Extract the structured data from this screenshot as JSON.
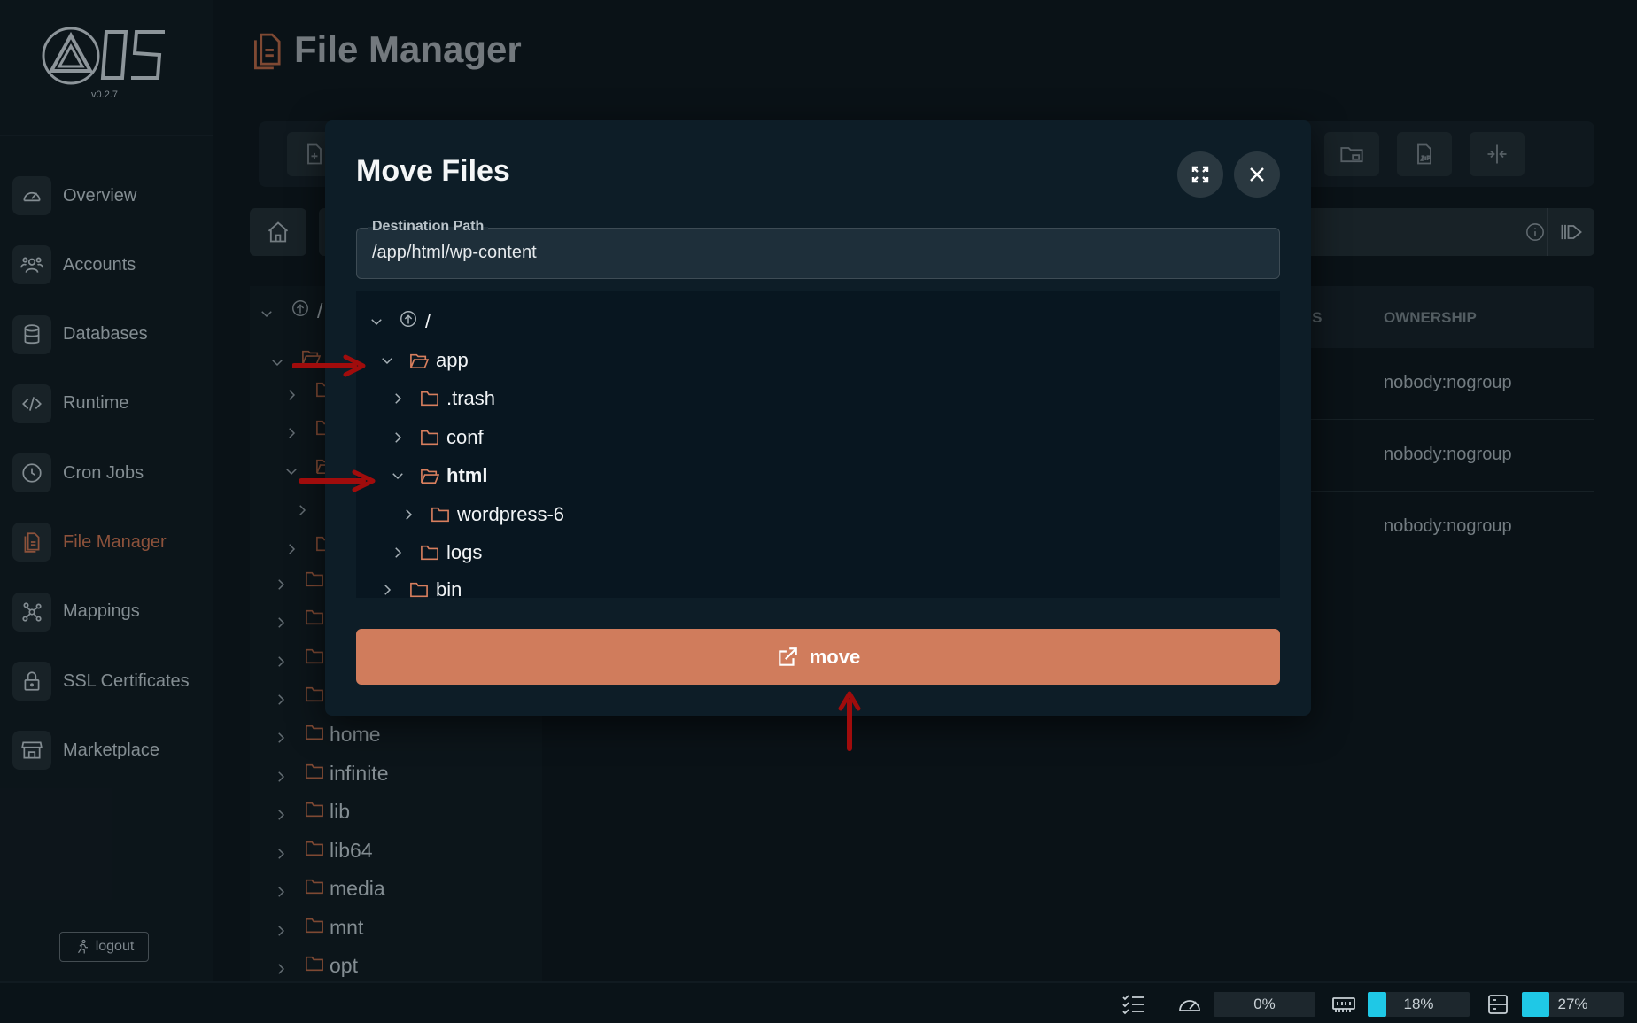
{
  "app": {
    "version": "v0.2.7"
  },
  "sidebar": {
    "items": [
      {
        "label": "Overview",
        "icon": "speedometer-icon"
      },
      {
        "label": "Accounts",
        "icon": "users-icon"
      },
      {
        "label": "Databases",
        "icon": "database-icon"
      },
      {
        "label": "Runtime",
        "icon": "code-icon"
      },
      {
        "label": "Cron Jobs",
        "icon": "clock-icon"
      },
      {
        "label": "File Manager",
        "icon": "file-manager-icon",
        "active": true
      },
      {
        "label": "Mappings",
        "icon": "mappings-icon"
      },
      {
        "label": "SSL Certificates",
        "icon": "lock-icon"
      },
      {
        "label": "Marketplace",
        "icon": "store-icon"
      }
    ],
    "logout_label": "logout"
  },
  "header": {
    "title": "File Manager"
  },
  "background_tree": {
    "root": "/",
    "visible_items": [
      "home",
      "infinite",
      "lib",
      "lib64",
      "media",
      "mnt",
      "opt"
    ]
  },
  "table": {
    "headers": {
      "perms_partial": "MS",
      "ownership": "OWNERSHIP"
    },
    "rows": [
      {
        "ownership": "nobody:nogroup"
      },
      {
        "ownership": "nobody:nogroup"
      },
      {
        "ownership": "nobody:nogroup"
      }
    ]
  },
  "modal": {
    "title": "Move Files",
    "destination_label": "Destination Path",
    "destination_value": "/app/html/wp-content",
    "tree": [
      {
        "label": "/",
        "depth": 0,
        "expanded": true,
        "root": true
      },
      {
        "label": "app",
        "depth": 1,
        "expanded": true
      },
      {
        "label": ".trash",
        "depth": 2,
        "expanded": false
      },
      {
        "label": "conf",
        "depth": 2,
        "expanded": false
      },
      {
        "label": "html",
        "depth": 2,
        "expanded": true,
        "selected": true
      },
      {
        "label": "wordpress-6",
        "depth": 3,
        "expanded": false
      },
      {
        "label": "logs",
        "depth": 2,
        "expanded": false
      },
      {
        "label": "bin",
        "depth": 1,
        "expanded": false
      }
    ],
    "move_label": "move"
  },
  "status_bar": {
    "cpu": {
      "value": "0%",
      "fraction": 0.0
    },
    "ram": {
      "value": "18%",
      "fraction": 0.18
    },
    "disk": {
      "value": "27%",
      "fraction": 0.27
    }
  },
  "colors": {
    "accent": "#d07c5c",
    "annotation_arrow": "#a00c0c",
    "meter_fill": "#1fc8e6"
  }
}
